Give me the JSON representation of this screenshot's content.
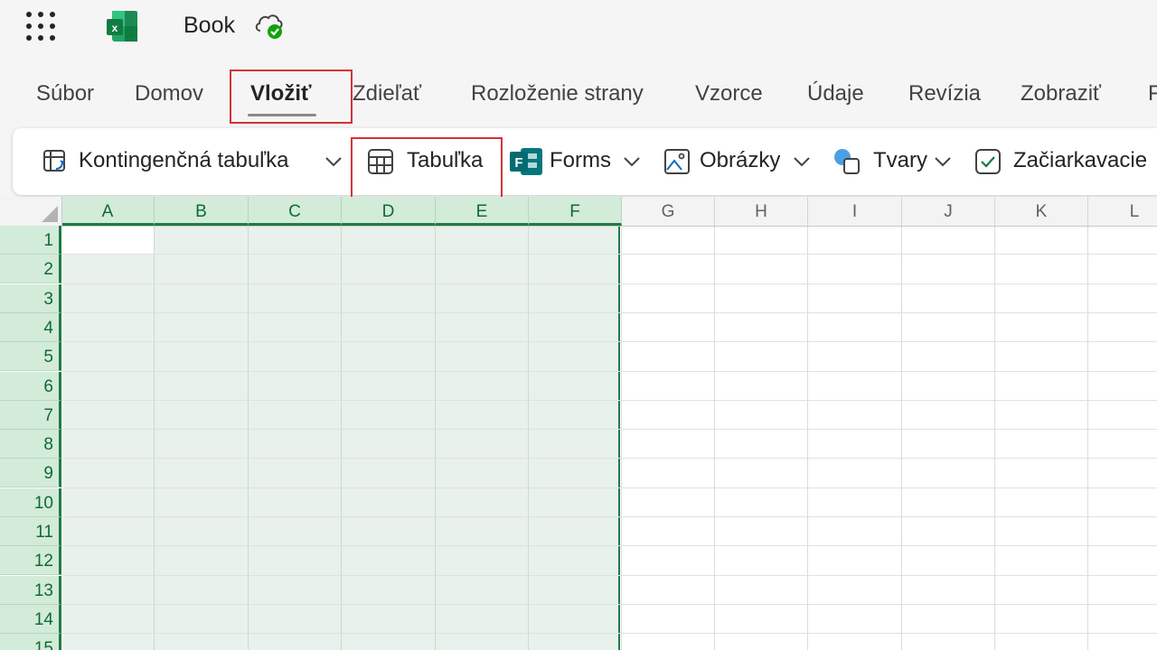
{
  "app": {
    "doc_title": "Book",
    "brand_color": "#107c41"
  },
  "tabs": [
    {
      "label": "Súbor"
    },
    {
      "label": "Domov"
    },
    {
      "label": "Vložiť"
    },
    {
      "label": "Zdieľať"
    },
    {
      "label": "Rozloženie strany"
    },
    {
      "label": "Vzorce"
    },
    {
      "label": "Údaje"
    },
    {
      "label": "Revízia"
    },
    {
      "label": "Zobraziť"
    }
  ],
  "active_tab": "Vložiť",
  "ribbon": {
    "pivot_label": "Kontingenčná tabuľka",
    "table_label": "Tabuľka",
    "forms_label": "Forms",
    "pictures_label": "Obrázky",
    "shapes_label": "Tvary",
    "checkbox_label": "Začiarkavacie"
  },
  "grid": {
    "columns": [
      "A",
      "B",
      "C",
      "D",
      "E",
      "F",
      "G",
      "H",
      "I",
      "J",
      "K",
      "L"
    ],
    "rows": [
      "1",
      "2",
      "3",
      "4",
      "5",
      "6",
      "7",
      "8",
      "9",
      "10",
      "11",
      "12",
      "13",
      "14",
      "15"
    ],
    "selected_columns": [
      "A",
      "B",
      "C",
      "D",
      "E",
      "F"
    ],
    "selection_color": "#1e7b44"
  },
  "icons": {
    "waffle": "app-launcher-icon",
    "excel": "excel-logo-icon",
    "cloud": "cloud-saved-icon"
  }
}
